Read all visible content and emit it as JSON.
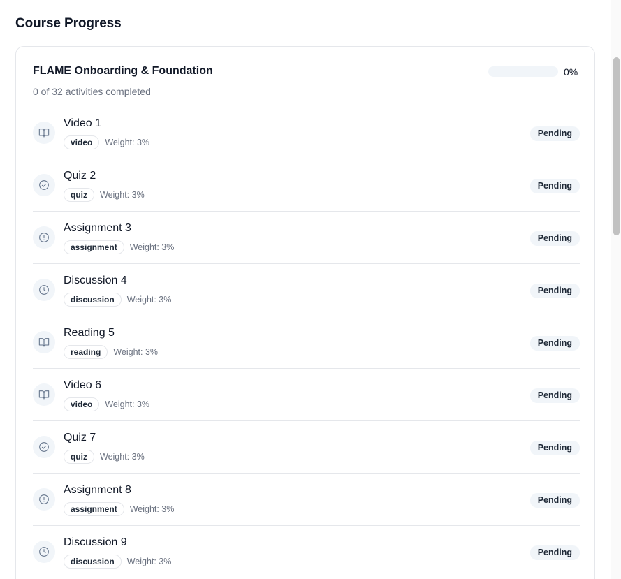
{
  "page": {
    "title": "Course Progress"
  },
  "course": {
    "title": "FLAME Onboarding & Foundation",
    "subtitle": "0 of 32 activities completed",
    "progress_label": "0%",
    "progress_fraction": 0
  },
  "activities": [
    {
      "title": "Video 1",
      "type": "video",
      "weight": "Weight: 3%",
      "status": "Pending",
      "icon": "book-open-icon"
    },
    {
      "title": "Quiz 2",
      "type": "quiz",
      "weight": "Weight: 3%",
      "status": "Pending",
      "icon": "check-circle-icon"
    },
    {
      "title": "Assignment 3",
      "type": "assignment",
      "weight": "Weight: 3%",
      "status": "Pending",
      "icon": "alert-circle-icon"
    },
    {
      "title": "Discussion 4",
      "type": "discussion",
      "weight": "Weight: 3%",
      "status": "Pending",
      "icon": "clock-icon"
    },
    {
      "title": "Reading 5",
      "type": "reading",
      "weight": "Weight: 3%",
      "status": "Pending",
      "icon": "book-open-icon"
    },
    {
      "title": "Video 6",
      "type": "video",
      "weight": "Weight: 3%",
      "status": "Pending",
      "icon": "book-open-icon"
    },
    {
      "title": "Quiz 7",
      "type": "quiz",
      "weight": "Weight: 3%",
      "status": "Pending",
      "icon": "check-circle-icon"
    },
    {
      "title": "Assignment 8",
      "type": "assignment",
      "weight": "Weight: 3%",
      "status": "Pending",
      "icon": "alert-circle-icon"
    },
    {
      "title": "Discussion 9",
      "type": "discussion",
      "weight": "Weight: 3%",
      "status": "Pending",
      "icon": "clock-icon"
    }
  ]
}
